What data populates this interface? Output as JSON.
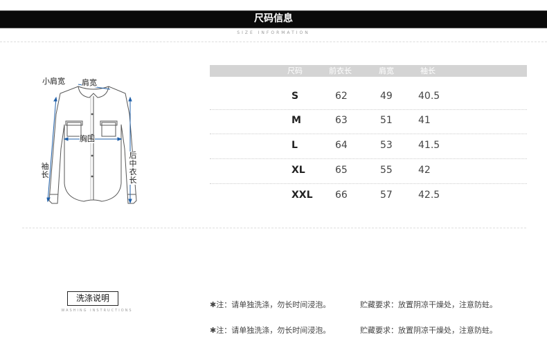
{
  "header": {
    "title": "尺码信息",
    "subtitle": "SIZE INFORMATION"
  },
  "diagram": {
    "labels": {
      "small_shoulder": "小肩宽",
      "shoulder": "肩宽",
      "chest": "胸围",
      "sleeve": "袖长",
      "back_length": "后中衣长"
    }
  },
  "size_table": {
    "headers": [
      "尺码",
      "前衣长",
      "肩宽",
      "袖长"
    ],
    "rows": [
      [
        "S",
        "62",
        "49",
        "40.5"
      ],
      [
        "M",
        "63",
        "51",
        "41"
      ],
      [
        "L",
        "64",
        "53",
        "41.5"
      ],
      [
        "XL",
        "65",
        "55",
        "42"
      ],
      [
        "XXL",
        "66",
        "57",
        "42.5"
      ]
    ]
  },
  "washing": {
    "title": "洗涤说明",
    "subtitle": "WASHING INSTRUCTIONS",
    "notes": [
      {
        "wash": "✱注：请单独洗涤，勿长时间浸泡。",
        "storage": "贮藏要求：放置阴凉干燥处，注意防蛀。"
      },
      {
        "wash": "✱注：请单独洗涤，勿长时间浸泡。",
        "storage": "贮藏要求：放置阴凉干燥处，注意防蛀。"
      }
    ]
  },
  "colors": {
    "title_bar": "#0a0a0a",
    "table_header": "#d4d4d4",
    "measure_line": "#1f5fa8"
  }
}
